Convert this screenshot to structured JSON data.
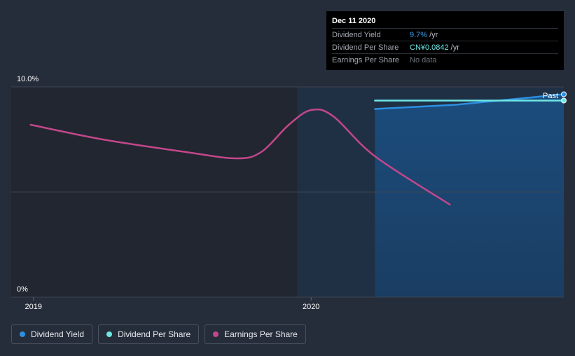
{
  "chart_data": {
    "type": "line",
    "ylim": [
      0,
      10
    ],
    "y_tick_labels": [
      "10.0%",
      "0%"
    ],
    "x_tick_labels": [
      "2019",
      "2020"
    ],
    "x_range": [
      2018.92,
      2020.91
    ],
    "past_region_start": 2019.95,
    "series": [
      {
        "name": "Dividend Yield",
        "color": "#2d8fe0",
        "points": [
          [
            2020.23,
            8.95
          ],
          [
            2020.52,
            9.15
          ],
          [
            2020.91,
            9.65
          ]
        ]
      },
      {
        "name": "Dividend Per Share",
        "color": "#6ee6e6",
        "points": [
          [
            2020.23,
            9.35
          ],
          [
            2020.91,
            9.35
          ]
        ]
      },
      {
        "name": "Earnings Per Share",
        "color": "#c2478a",
        "points": [
          [
            2018.99,
            8.2
          ],
          [
            2019.25,
            7.5
          ],
          [
            2019.55,
            6.9
          ],
          [
            2019.73,
            6.6
          ],
          [
            2019.82,
            6.9
          ],
          [
            2019.92,
            8.2
          ],
          [
            2020.0,
            8.9
          ],
          [
            2020.08,
            8.6
          ],
          [
            2020.23,
            6.7
          ],
          [
            2020.5,
            4.4
          ]
        ]
      }
    ],
    "annotation": "Past"
  },
  "tooltip": {
    "date": "Dec 11 2020",
    "rows": [
      {
        "label": "Dividend Yield",
        "value": "9.7%",
        "unit": "/yr"
      },
      {
        "label": "Dividend Per Share",
        "value": "CN¥0.0842",
        "unit": "/yr"
      },
      {
        "label": "Earnings Per Share",
        "value": "No data"
      }
    ]
  },
  "legend": [
    {
      "label": "Dividend Yield",
      "color": "#2d8fe0"
    },
    {
      "label": "Dividend Per Share",
      "color": "#6ee6e6"
    },
    {
      "label": "Earnings Per Share",
      "color": "#c2478a"
    }
  ]
}
